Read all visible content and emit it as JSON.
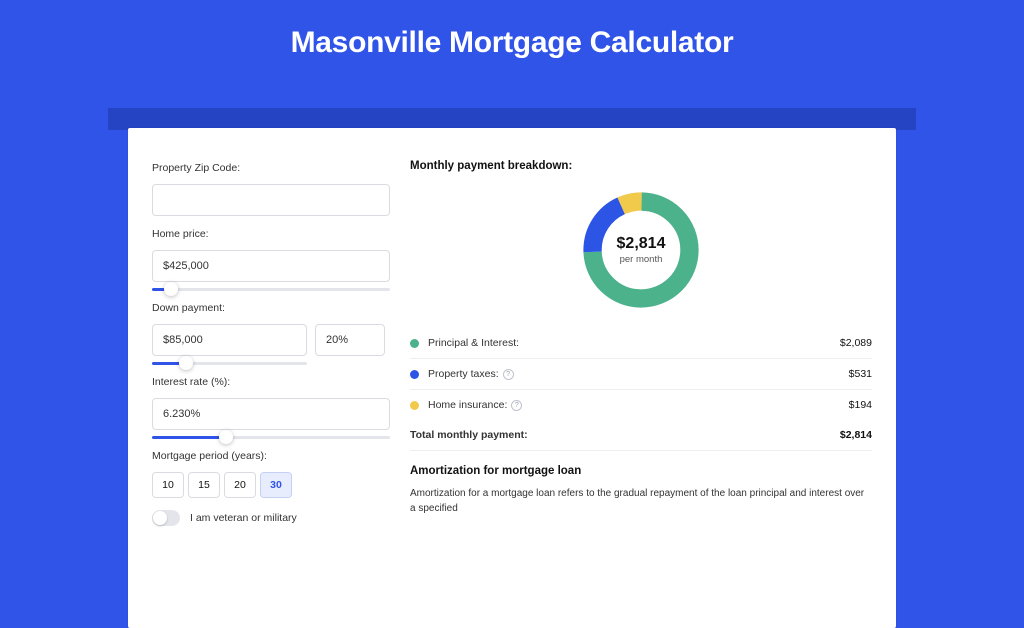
{
  "page": {
    "title": "Masonville Mortgage Calculator"
  },
  "fields": {
    "zip": {
      "label": "Property Zip Code:",
      "value": ""
    },
    "price": {
      "label": "Home price:",
      "value": "$425,000",
      "slider_pct": 8
    },
    "down": {
      "label": "Down payment:",
      "value": "$85,000",
      "pct_value": "20%",
      "slider_pct": 22
    },
    "rate": {
      "label": "Interest rate (%):",
      "value": "6.230%",
      "slider_pct": 31
    },
    "term": {
      "label": "Mortgage period (years):",
      "options": [
        "10",
        "15",
        "20",
        "30"
      ],
      "selected": "30"
    },
    "veteran": {
      "label": "I am veteran or military",
      "checked": false
    }
  },
  "breakdown": {
    "title": "Monthly payment breakdown:",
    "center_value": "$2,814",
    "center_sub": "per month",
    "items": [
      {
        "label": "Principal & Interest:",
        "value": "$2,089",
        "color": "#4cb28c",
        "info": false
      },
      {
        "label": "Property taxes:",
        "value": "$531",
        "color": "#2c55e6",
        "info": true
      },
      {
        "label": "Home insurance:",
        "value": "$194",
        "color": "#f1c94b",
        "info": true
      }
    ],
    "total_label": "Total monthly payment:",
    "total_value": "$2,814"
  },
  "chart_data": {
    "type": "pie",
    "title": "Monthly payment breakdown",
    "series": [
      {
        "name": "Principal & Interest",
        "value": 2089,
        "color": "#4cb28c"
      },
      {
        "name": "Property taxes",
        "value": 531,
        "color": "#2c55e6"
      },
      {
        "name": "Home insurance",
        "value": 194,
        "color": "#f1c94b"
      }
    ],
    "total": 2814,
    "center_label": "$2,814 per month"
  },
  "amortization": {
    "title": "Amortization for mortgage loan",
    "text": "Amortization for a mortgage loan refers to the gradual repayment of the loan principal and interest over a specified"
  }
}
